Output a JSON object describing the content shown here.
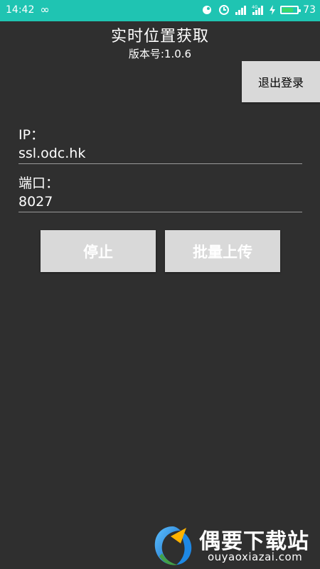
{
  "status_bar": {
    "time": "14:42",
    "battery_percent": "73",
    "battery_level": 0.73,
    "icons": [
      "infinity-icon",
      "app-icon",
      "alarm-icon",
      "signal-icon",
      "4g-signal-icon",
      "charging-icon",
      "battery-icon"
    ],
    "background": "#1fc4b2"
  },
  "header": {
    "title": "实时位置获取",
    "version": "版本号:1.0.6"
  },
  "logout_button": "退出登录",
  "form": {
    "ip_label": "IP：",
    "ip_value": "ssl.odc.hk",
    "port_label": "端口：",
    "port_value": "8027"
  },
  "actions": {
    "stop": "停止",
    "batch_upload": "批量上传"
  },
  "watermark": {
    "title": "偶要下载站",
    "url": "ouyaoxiazai.com"
  },
  "colors": {
    "background": "#2f2f2f",
    "button": "#d9d9d9"
  }
}
